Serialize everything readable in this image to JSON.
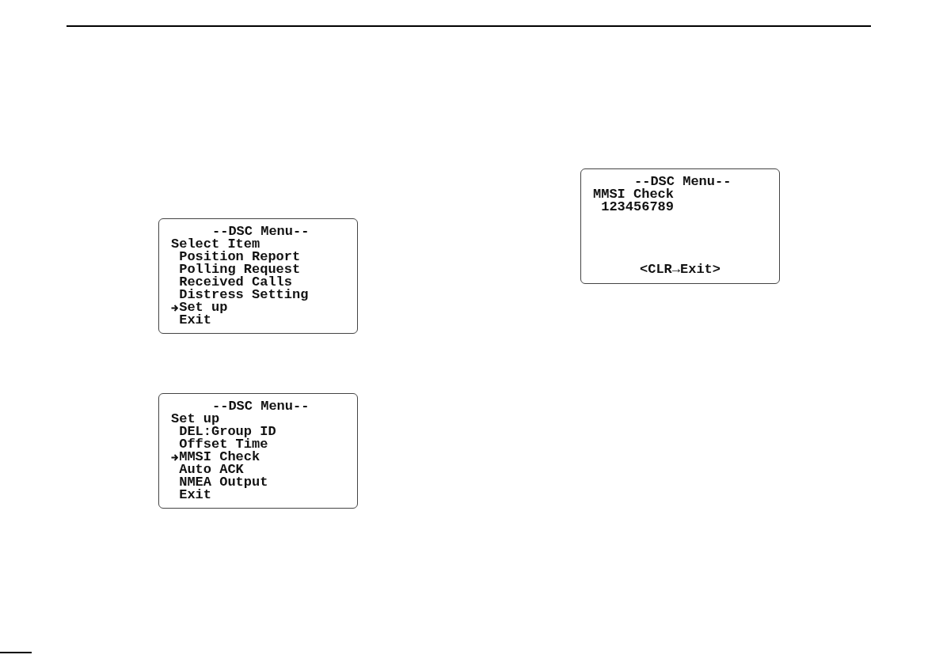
{
  "screens": [
    {
      "kind": "menu",
      "title": "--DSC Menu--",
      "heading": "Select Item",
      "items": [
        {
          "label": "Position Report",
          "selected": false
        },
        {
          "label": "Polling Request",
          "selected": false
        },
        {
          "label": "Received Calls",
          "selected": false
        },
        {
          "label": "Distress Setting",
          "selected": false
        },
        {
          "label": "Set up",
          "selected": true
        },
        {
          "label": "Exit",
          "selected": false
        }
      ]
    },
    {
      "kind": "menu",
      "title": "--DSC Menu--",
      "heading": "Set up",
      "items": [
        {
          "label": "DEL:Group ID",
          "selected": false
        },
        {
          "label": "Offset Time",
          "selected": false
        },
        {
          "label": "MMSI Check",
          "selected": true
        },
        {
          "label": "Auto ACK",
          "selected": false
        },
        {
          "label": "NMEA Output",
          "selected": false
        },
        {
          "label": "Exit",
          "selected": false
        }
      ]
    },
    {
      "kind": "info",
      "title": "--DSC Menu--",
      "heading": "MMSI Check",
      "value": "123456789",
      "footer": "<CLR→Exit>"
    }
  ]
}
